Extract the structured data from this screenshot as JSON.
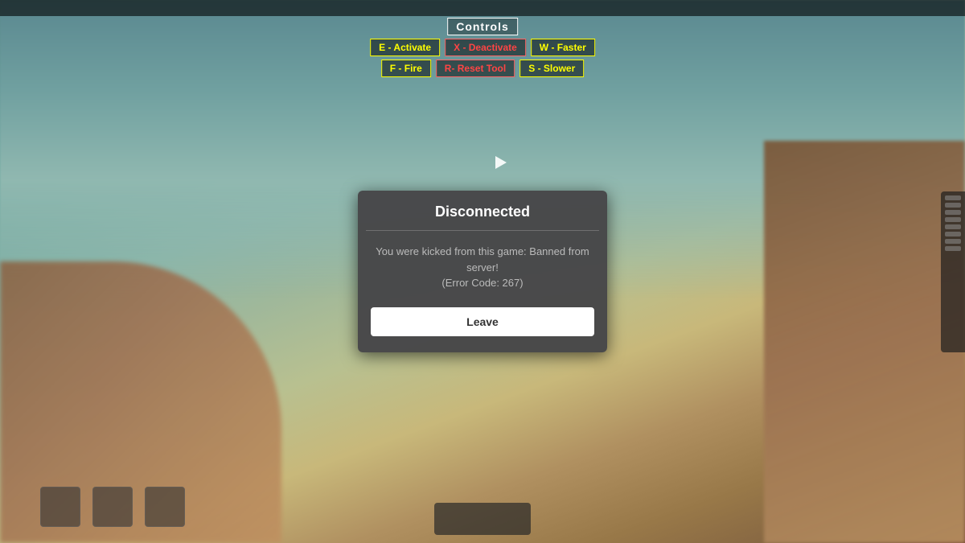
{
  "background": {
    "colors": {
      "sky_top": "#5a8890",
      "sky_bottom": "#90b8b0",
      "terrain": "#9a7050"
    }
  },
  "top_bar": {
    "bg": "rgba(0,0,0,0.6)"
  },
  "controls": {
    "title": "Controls",
    "row1": [
      {
        "key": "E",
        "label": "E - Activate",
        "style": "yellow"
      },
      {
        "key": "X",
        "label": "X - Deactivate",
        "style": "red"
      },
      {
        "key": "W",
        "label": "W - Faster",
        "style": "yellow"
      }
    ],
    "row2": [
      {
        "key": "F",
        "label": "F - Fire",
        "style": "yellow"
      },
      {
        "key": "R",
        "label": "R- Reset Tool",
        "style": "red"
      },
      {
        "key": "S",
        "label": "S - Slower",
        "style": "yellow"
      }
    ]
  },
  "modal": {
    "title": "Disconnected",
    "message_line1": "You were kicked from this game: Banned from",
    "message_line2": "server!",
    "message_line3": "(Error Code: 267)",
    "leave_button_label": "Leave"
  }
}
